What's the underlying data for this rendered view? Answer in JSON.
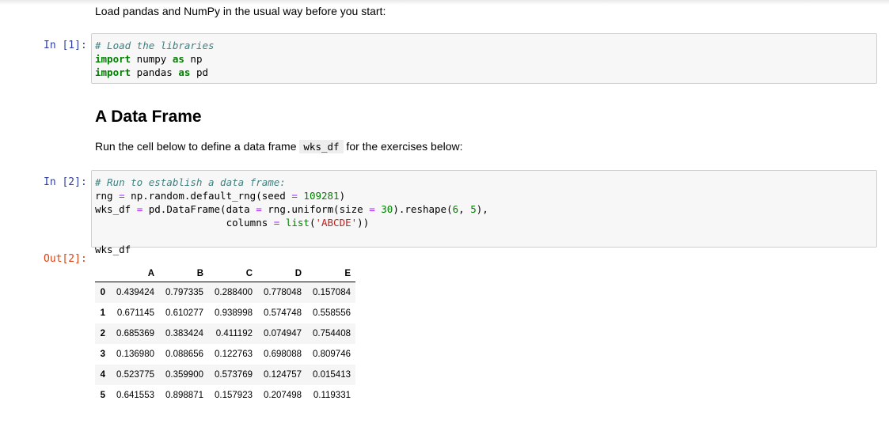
{
  "intro_text": "Load pandas and NumPy in the usual way before you start:",
  "cell1": {
    "prompt": "In [1]:",
    "comment": "# Load the libraries",
    "line2_kw": "import",
    "line2_mod": " numpy ",
    "line2_as": "as",
    "line2_alias": " np",
    "line3_kw": "import",
    "line3_mod": " pandas ",
    "line3_as": "as",
    "line3_alias": " pd"
  },
  "section_title": "A Data Frame",
  "run_text_before": "Run the cell below to define a data frame ",
  "run_text_code": "wks_df",
  "run_text_after": " for the exercises below:",
  "cell2": {
    "prompt": "In [2]:",
    "comment": "# Run to establish a data frame:",
    "l2a": "rng ",
    "l2b": "=",
    "l2c": " np.random.default_rng(seed ",
    "l2d": "=",
    "l2e": " ",
    "l2f": "109281",
    "l2g": ")",
    "l3a": "wks_df ",
    "l3b": "=",
    "l3c": " pd.DataFrame(data ",
    "l3d": "=",
    "l3e": " rng.uniform(size ",
    "l3f": "=",
    "l3g": " ",
    "l3h": "30",
    "l3i": ").reshape(",
    "l3j": "6",
    "l3k": ", ",
    "l3l": "5",
    "l3m": "),",
    "l4a": "                      columns ",
    "l4b": "=",
    "l4c": " ",
    "l4d": "list",
    "l4e": "(",
    "l4f": "'ABCDE'",
    "l4g": "))",
    "l6": "wks_df"
  },
  "out2_prompt": "Out[2]:",
  "dataframe": {
    "columns": [
      "A",
      "B",
      "C",
      "D",
      "E"
    ],
    "rows": [
      {
        "index": "0",
        "values": [
          "0.439424",
          "0.797335",
          "0.288400",
          "0.778048",
          "0.157084"
        ]
      },
      {
        "index": "1",
        "values": [
          "0.671145",
          "0.610277",
          "0.938998",
          "0.574748",
          "0.558556"
        ]
      },
      {
        "index": "2",
        "values": [
          "0.685369",
          "0.383424",
          "0.411192",
          "0.074947",
          "0.754408"
        ]
      },
      {
        "index": "3",
        "values": [
          "0.136980",
          "0.088656",
          "0.122763",
          "0.698088",
          "0.809746"
        ]
      },
      {
        "index": "4",
        "values": [
          "0.523775",
          "0.359900",
          "0.573769",
          "0.124757",
          "0.015413"
        ]
      },
      {
        "index": "5",
        "values": [
          "0.641553",
          "0.898871",
          "0.157923",
          "0.207498",
          "0.119331"
        ]
      }
    ]
  }
}
